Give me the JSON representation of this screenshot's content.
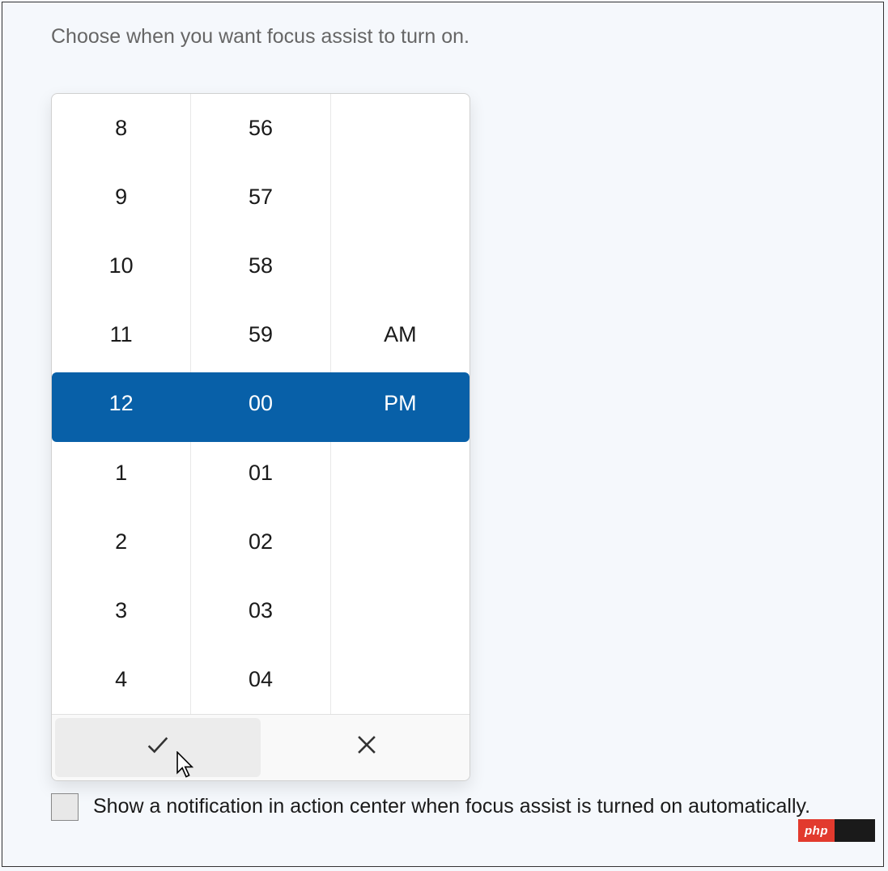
{
  "header": {
    "instruction": "Choose when you want focus assist to turn on."
  },
  "time_picker": {
    "hours": [
      "8",
      "9",
      "10",
      "11",
      "12",
      "1",
      "2",
      "3",
      "4"
    ],
    "minutes": [
      "56",
      "57",
      "58",
      "59",
      "00",
      "01",
      "02",
      "03",
      "04"
    ],
    "periods": [
      "",
      "",
      "",
      "AM",
      "PM",
      "",
      "",
      "",
      ""
    ],
    "selected_index": 4,
    "selected_hour": "12",
    "selected_minute": "00",
    "selected_period": "PM",
    "accent_color": "#0860a8"
  },
  "checkbox": {
    "checked": false,
    "label": "Show a notification in action center when focus assist is turned on automatically."
  },
  "watermark": {
    "brand": "php"
  }
}
